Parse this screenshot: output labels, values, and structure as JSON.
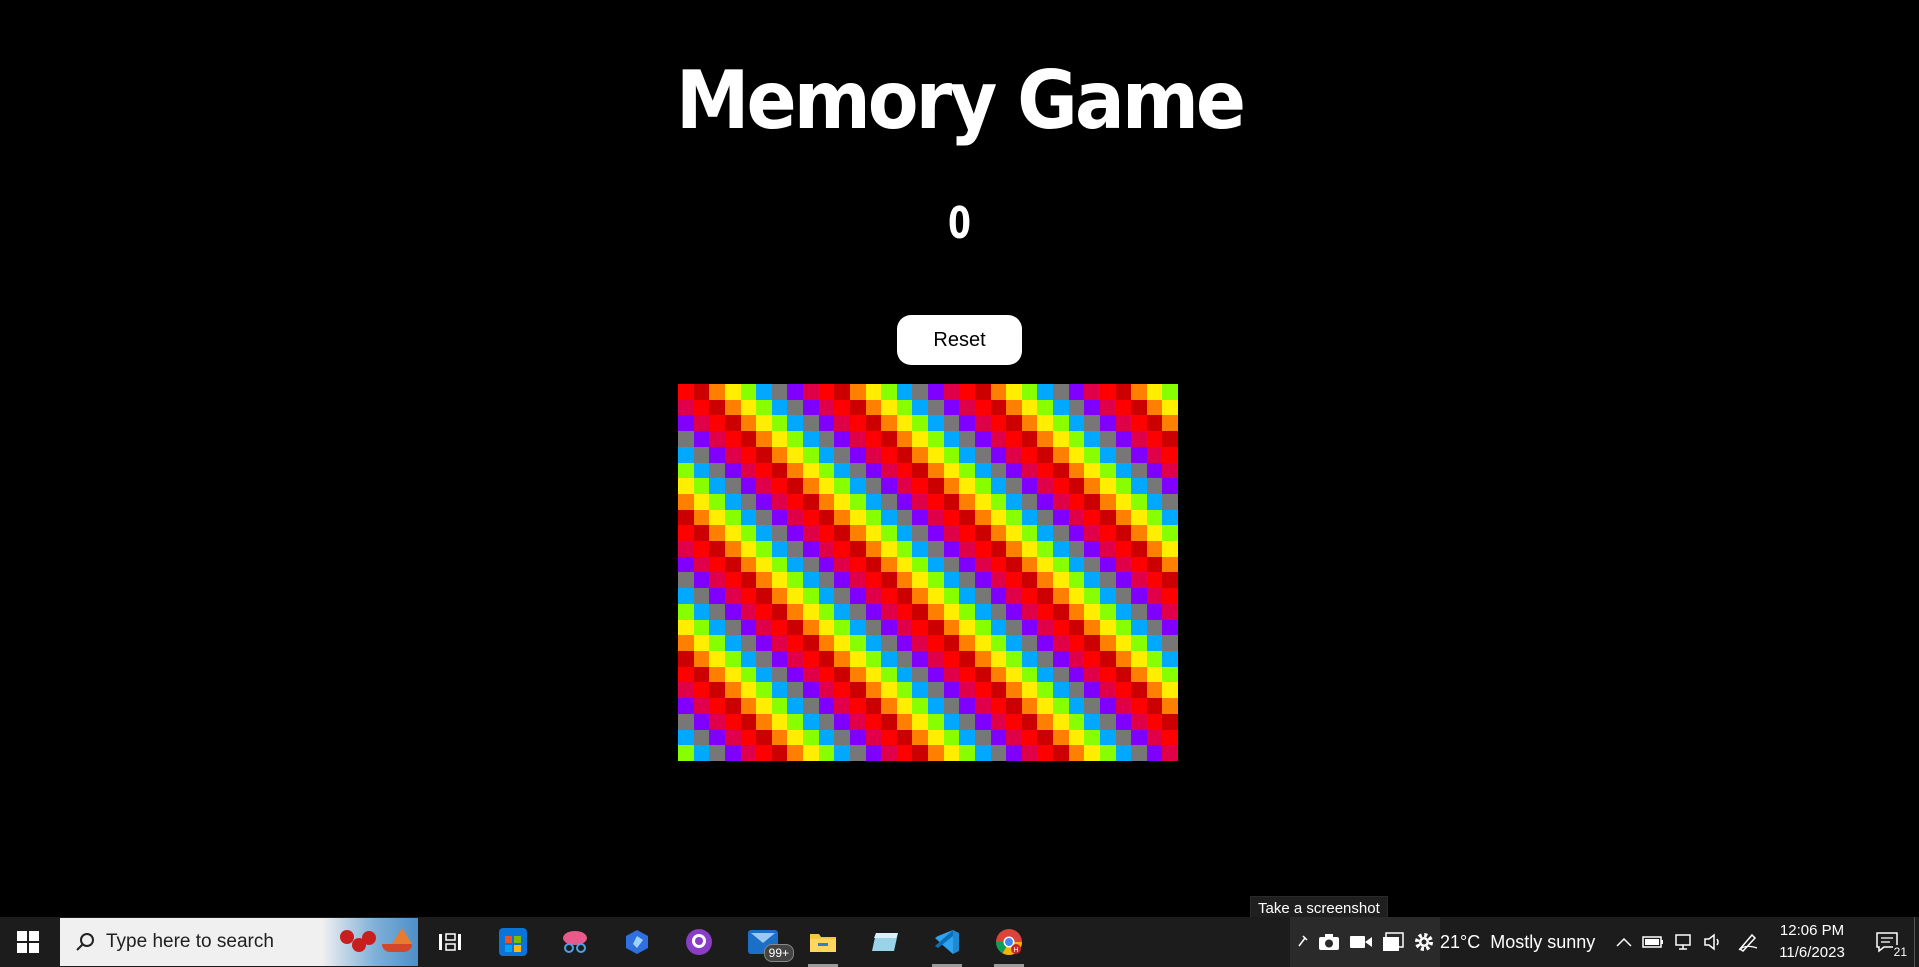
{
  "game": {
    "title": "Memory Game",
    "score": "0",
    "reset_label": "Reset",
    "board_colors": [
      "#e0004a",
      "#ff0000",
      "#cc0000",
      "#ff8000",
      "#ffee00",
      "#88ff00",
      "#00cc44",
      "#00a8ff",
      "#8000ff",
      "#777777"
    ]
  },
  "tooltip": {
    "text": "Take a screenshot"
  },
  "taskbar": {
    "search_placeholder": "Type here to search",
    "mail_badge": "99+",
    "weather_temp": "21°C",
    "weather_text": "Mostly sunny",
    "time": "12:06 PM",
    "date": "11/6/2023",
    "notification_count": "21",
    "pinned_apps": [
      {
        "name": "task-view-icon"
      },
      {
        "name": "microsoft-store-icon"
      },
      {
        "name": "snip-sketch-icon"
      },
      {
        "name": "bing-chat-icon"
      },
      {
        "name": "github-desktop-icon"
      },
      {
        "name": "mail-icon"
      },
      {
        "name": "file-explorer-icon"
      },
      {
        "name": "notes-icon"
      },
      {
        "name": "vscode-icon"
      },
      {
        "name": "chrome-icon"
      }
    ]
  }
}
